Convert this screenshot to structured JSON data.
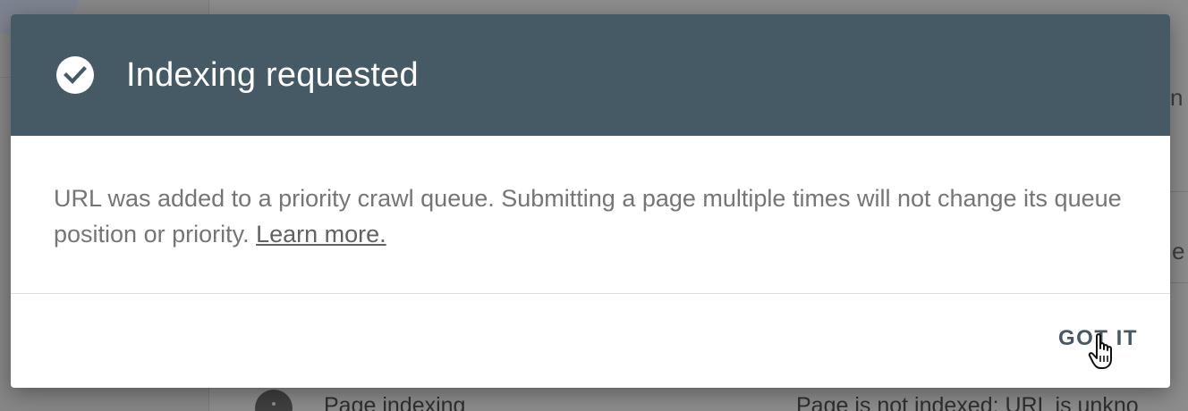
{
  "dialog": {
    "title": "Indexing requested",
    "message": "URL was added to a priority crawl queue. Submitting a page multiple times will not change its queue position or priority.",
    "learn_more": "Learn more.",
    "action": "GOT IT",
    "header_color": "#455a64"
  },
  "background": {
    "right_fragment_1": "n",
    "right_fragment_2": "e",
    "row_label": "Page indexing",
    "row_status": "Page is not indexed: URL is unkno"
  },
  "icons": {
    "check": "check-circle-icon",
    "info": "info-icon",
    "cursor": "hand-pointer-icon"
  }
}
